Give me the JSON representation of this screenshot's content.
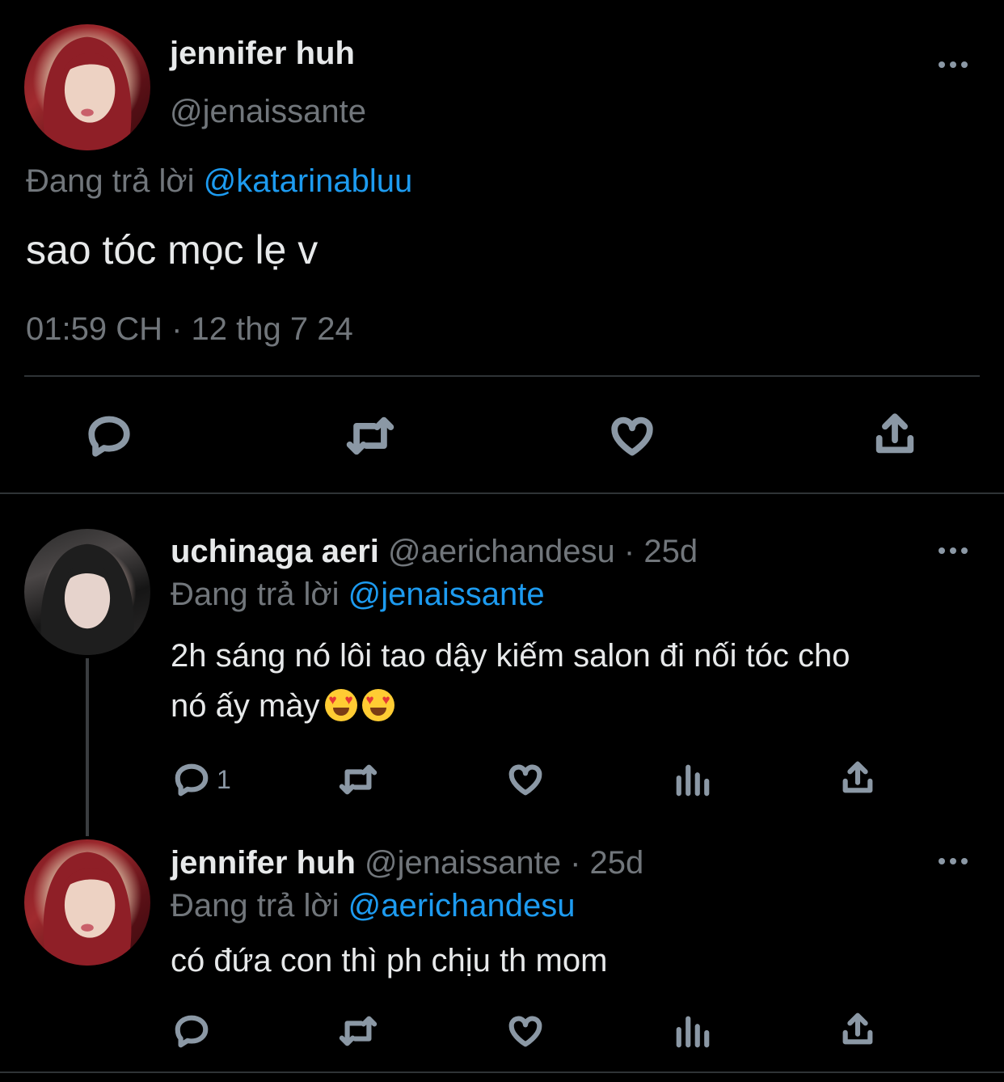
{
  "main_tweet": {
    "display_name": "jennifer huh",
    "handle": "@jenaissante",
    "replying_prefix": "Đang trả lời",
    "replying_to": "@katarinabluu",
    "text": "sao tóc mọc lẹ v",
    "timestamp": "01:59 CH · 12 thg 7 24",
    "actions": {
      "reply_icon": "speech-bubble",
      "retweet_icon": "retweet-arrows",
      "like_icon": "heart",
      "share_icon": "share-arrow"
    }
  },
  "replies": [
    {
      "display_name": "uchinaga aeri",
      "handle": "@aerichandesu",
      "time": "· 25d",
      "replying_prefix": "Đang trả lời",
      "replying_to": "@jenaissante",
      "text_line1": "2h sáng nó lôi tao dậy kiếm salon đi nối tóc cho",
      "text_line2": "nó ấy mày",
      "emojis": [
        "heart-eyes-emoji",
        "heart-eyes-emoji"
      ],
      "reply_count": "1"
    },
    {
      "display_name": "jennifer huh",
      "handle": "@jenaissante",
      "time": "· 25d",
      "replying_prefix": "Đang trả lời",
      "replying_to": "@aerichandesu",
      "text": "có đứa con thì ph chịu th mom"
    }
  ],
  "colors": {
    "background": "#000000",
    "text": "#e7e9ea",
    "muted": "#71767b",
    "link": "#1d9bf0",
    "divider": "#2f3336"
  }
}
